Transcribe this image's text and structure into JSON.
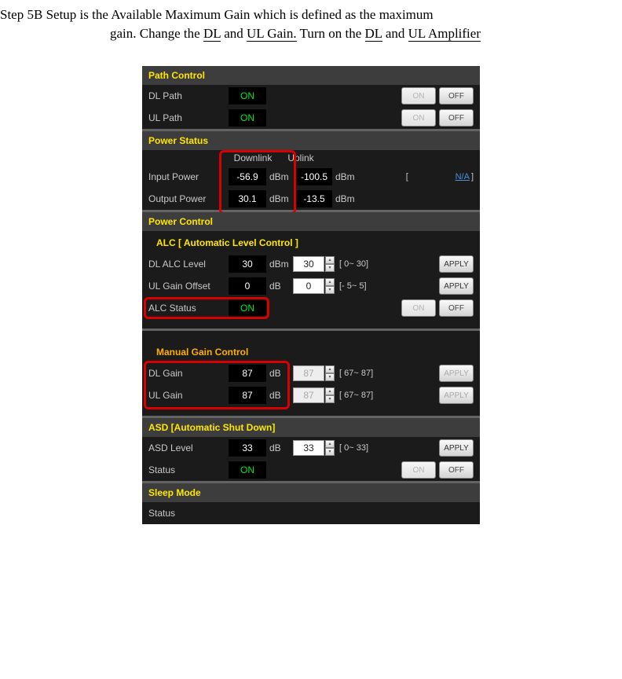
{
  "instruction": {
    "step_label": "Step 5B",
    "line1_rest": " Setup is the Available Maximum Gain which is defined as the maximum",
    "line2_pre": "gain. Change the ",
    "dl_text": "DL",
    "line2_and": " and ",
    "ul_gain": "UL Gain.",
    "line2_turn": " Turn on the ",
    "dl_text2": "DL",
    "line2_and2": " and ",
    "ul_amp": "UL Amplifier"
  },
  "path_control": {
    "title": "Path Control",
    "dl_path_label": "DL Path",
    "dl_path_value": "ON",
    "ul_path_label": "UL Path",
    "ul_path_value": "ON",
    "on_btn": "ON",
    "off_btn": "OFF"
  },
  "power_status": {
    "title": "Power Status",
    "col_downlink": "Downlink",
    "col_uplink": "Uplink",
    "input_label": "Input Power",
    "in_dl": "-56.9",
    "in_ul": "-100.5",
    "output_label": "Output Power",
    "out_dl": "30.1",
    "out_ul": "-13.5",
    "unit_dbm": "dBm",
    "link_na": "N/A"
  },
  "power_control": {
    "title": "Power Control",
    "alc_header": "ALC [ Automatic Level Control ]",
    "dl_alc_label": "DL ALC Level",
    "dl_alc_val": "30",
    "dl_alc_input": "30",
    "dl_alc_range": "[ 0~ 30]",
    "ul_gain_offset_label": "UL Gain Offset",
    "ul_gain_offset_val": "0",
    "ul_gain_offset_input": "0",
    "ul_gain_offset_range": "[- 5~  5]",
    "alc_status_label": "ALC Status",
    "alc_status_val": "ON",
    "unit_dbm": "dBm",
    "unit_db": "dB",
    "apply": "APPLY",
    "on_btn": "ON",
    "off_btn": "OFF"
  },
  "manual_gain": {
    "title": "Manual Gain Control",
    "dl_gain_label": "DL Gain",
    "dl_gain_val": "87",
    "dl_gain_input": "87",
    "dl_gain_range": "[ 67~ 87]",
    "ul_gain_label": "UL Gain",
    "ul_gain_val": "87",
    "ul_gain_input": "87",
    "ul_gain_range": "[ 67~ 87]",
    "unit_db": "dB",
    "apply": "APPLY"
  },
  "asd": {
    "title": "ASD [Automatic Shut Down]",
    "level_label": "ASD Level",
    "level_val": "33",
    "level_input": "33",
    "level_range": "[ 0~ 33]",
    "status_label": "Status",
    "status_val": "ON",
    "unit_db": "dB",
    "apply": "APPLY",
    "on_btn": "ON",
    "off_btn": "OFF"
  },
  "sleep": {
    "title": "Sleep Mode",
    "status_label": "Status"
  }
}
